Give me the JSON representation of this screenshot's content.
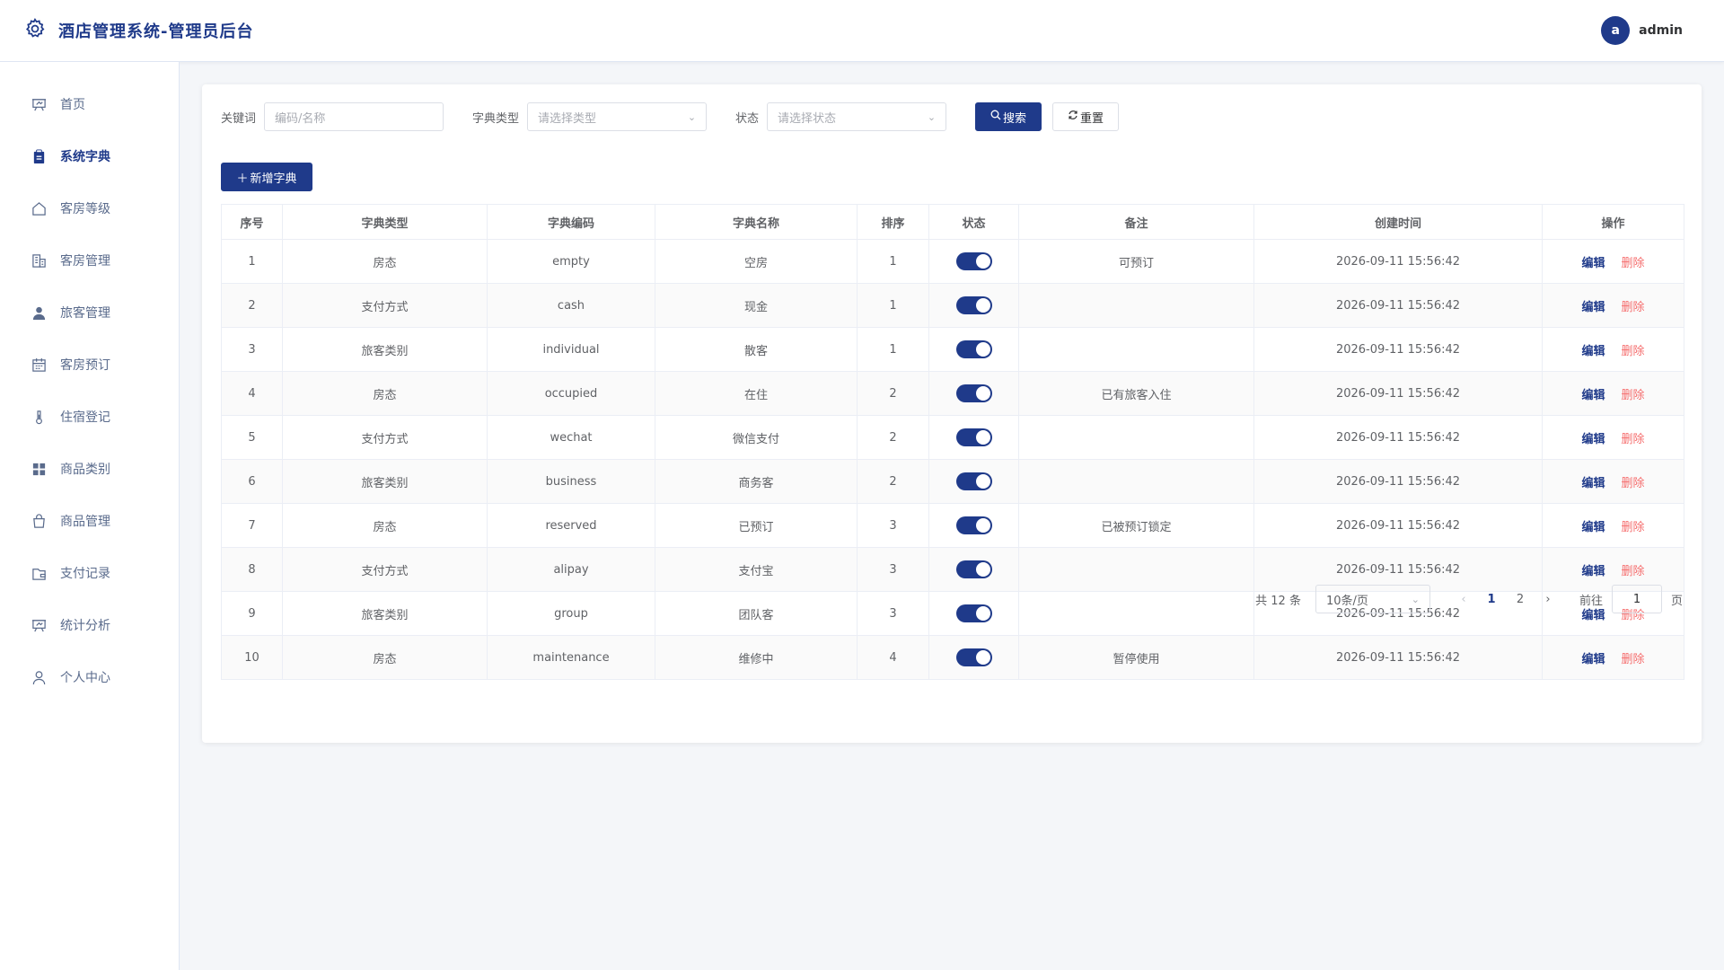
{
  "header": {
    "title": "酒店管理系统-管理员后台",
    "logo_icon": "gear-icon",
    "avatar_letter": "a",
    "username": "admin"
  },
  "colors": {
    "primary": "#1f3a8a",
    "danger": "#f56c6c",
    "background": "#f4f6f9"
  },
  "sidebar": {
    "items": [
      {
        "label": "首页",
        "icon": "dashboard-icon",
        "active": false
      },
      {
        "label": "系统字典",
        "icon": "clipboard-icon",
        "active": true
      },
      {
        "label": "客房等级",
        "icon": "house-icon",
        "active": false
      },
      {
        "label": "客房管理",
        "icon": "building-icon",
        "active": false
      },
      {
        "label": "旅客管理",
        "icon": "user-filled-icon",
        "active": false
      },
      {
        "label": "客房预订",
        "icon": "calendar-icon",
        "active": false
      },
      {
        "label": "住宿登记",
        "icon": "thermometer-icon",
        "active": false
      },
      {
        "label": "商品类别",
        "icon": "grid-icon",
        "active": false
      },
      {
        "label": "商品管理",
        "icon": "shopping-bag-icon",
        "active": false
      },
      {
        "label": "支付记录",
        "icon": "wallet-icon",
        "active": false
      },
      {
        "label": "统计分析",
        "icon": "chart-board-icon",
        "active": false
      },
      {
        "label": "个人中心",
        "icon": "user-icon",
        "active": false
      }
    ]
  },
  "filters": {
    "keyword_label": "关键词",
    "keyword_placeholder": "编码/名称",
    "type_label": "字典类型",
    "type_placeholder": "请选择类型",
    "status_label": "状态",
    "status_placeholder": "请选择状态",
    "search_label": "搜索",
    "reset_label": "重置"
  },
  "toolbar": {
    "add_label": "新增字典"
  },
  "table": {
    "columns": [
      "序号",
      "字典类型",
      "字典编码",
      "字典名称",
      "排序",
      "状态",
      "备注",
      "创建时间",
      "操作"
    ],
    "edit_label": "编辑",
    "delete_label": "删除",
    "rows": [
      {
        "no": "1",
        "type": "房态",
        "code": "empty",
        "name": "空房",
        "sort": "1",
        "enabled": true,
        "remark": "可预订",
        "created": "2026-09-11 15:56:42"
      },
      {
        "no": "2",
        "type": "支付方式",
        "code": "cash",
        "name": "现金",
        "sort": "1",
        "enabled": true,
        "remark": "",
        "created": "2026-09-11 15:56:42"
      },
      {
        "no": "3",
        "type": "旅客类别",
        "code": "individual",
        "name": "散客",
        "sort": "1",
        "enabled": true,
        "remark": "",
        "created": "2026-09-11 15:56:42"
      },
      {
        "no": "4",
        "type": "房态",
        "code": "occupied",
        "name": "在住",
        "sort": "2",
        "enabled": true,
        "remark": "已有旅客入住",
        "created": "2026-09-11 15:56:42"
      },
      {
        "no": "5",
        "type": "支付方式",
        "code": "wechat",
        "name": "微信支付",
        "sort": "2",
        "enabled": true,
        "remark": "",
        "created": "2026-09-11 15:56:42"
      },
      {
        "no": "6",
        "type": "旅客类别",
        "code": "business",
        "name": "商务客",
        "sort": "2",
        "enabled": true,
        "remark": "",
        "created": "2026-09-11 15:56:42"
      },
      {
        "no": "7",
        "type": "房态",
        "code": "reserved",
        "name": "已预订",
        "sort": "3",
        "enabled": true,
        "remark": "已被预订锁定",
        "created": "2026-09-11 15:56:42"
      },
      {
        "no": "8",
        "type": "支付方式",
        "code": "alipay",
        "name": "支付宝",
        "sort": "3",
        "enabled": true,
        "remark": "",
        "created": "2026-09-11 15:56:42"
      },
      {
        "no": "9",
        "type": "旅客类别",
        "code": "group",
        "name": "团队客",
        "sort": "3",
        "enabled": true,
        "remark": "",
        "created": "2026-09-11 15:56:42"
      },
      {
        "no": "10",
        "type": "房态",
        "code": "maintenance",
        "name": "维修中",
        "sort": "4",
        "enabled": true,
        "remark": "暂停使用",
        "created": "2026-09-11 15:56:42"
      }
    ]
  },
  "pagination": {
    "total_text": "共 12 条",
    "page_size": "10条/页",
    "pages": [
      "1",
      "2"
    ],
    "current_page": "1",
    "goto_label": "前往",
    "goto_value": "1",
    "page_suffix": "页"
  }
}
